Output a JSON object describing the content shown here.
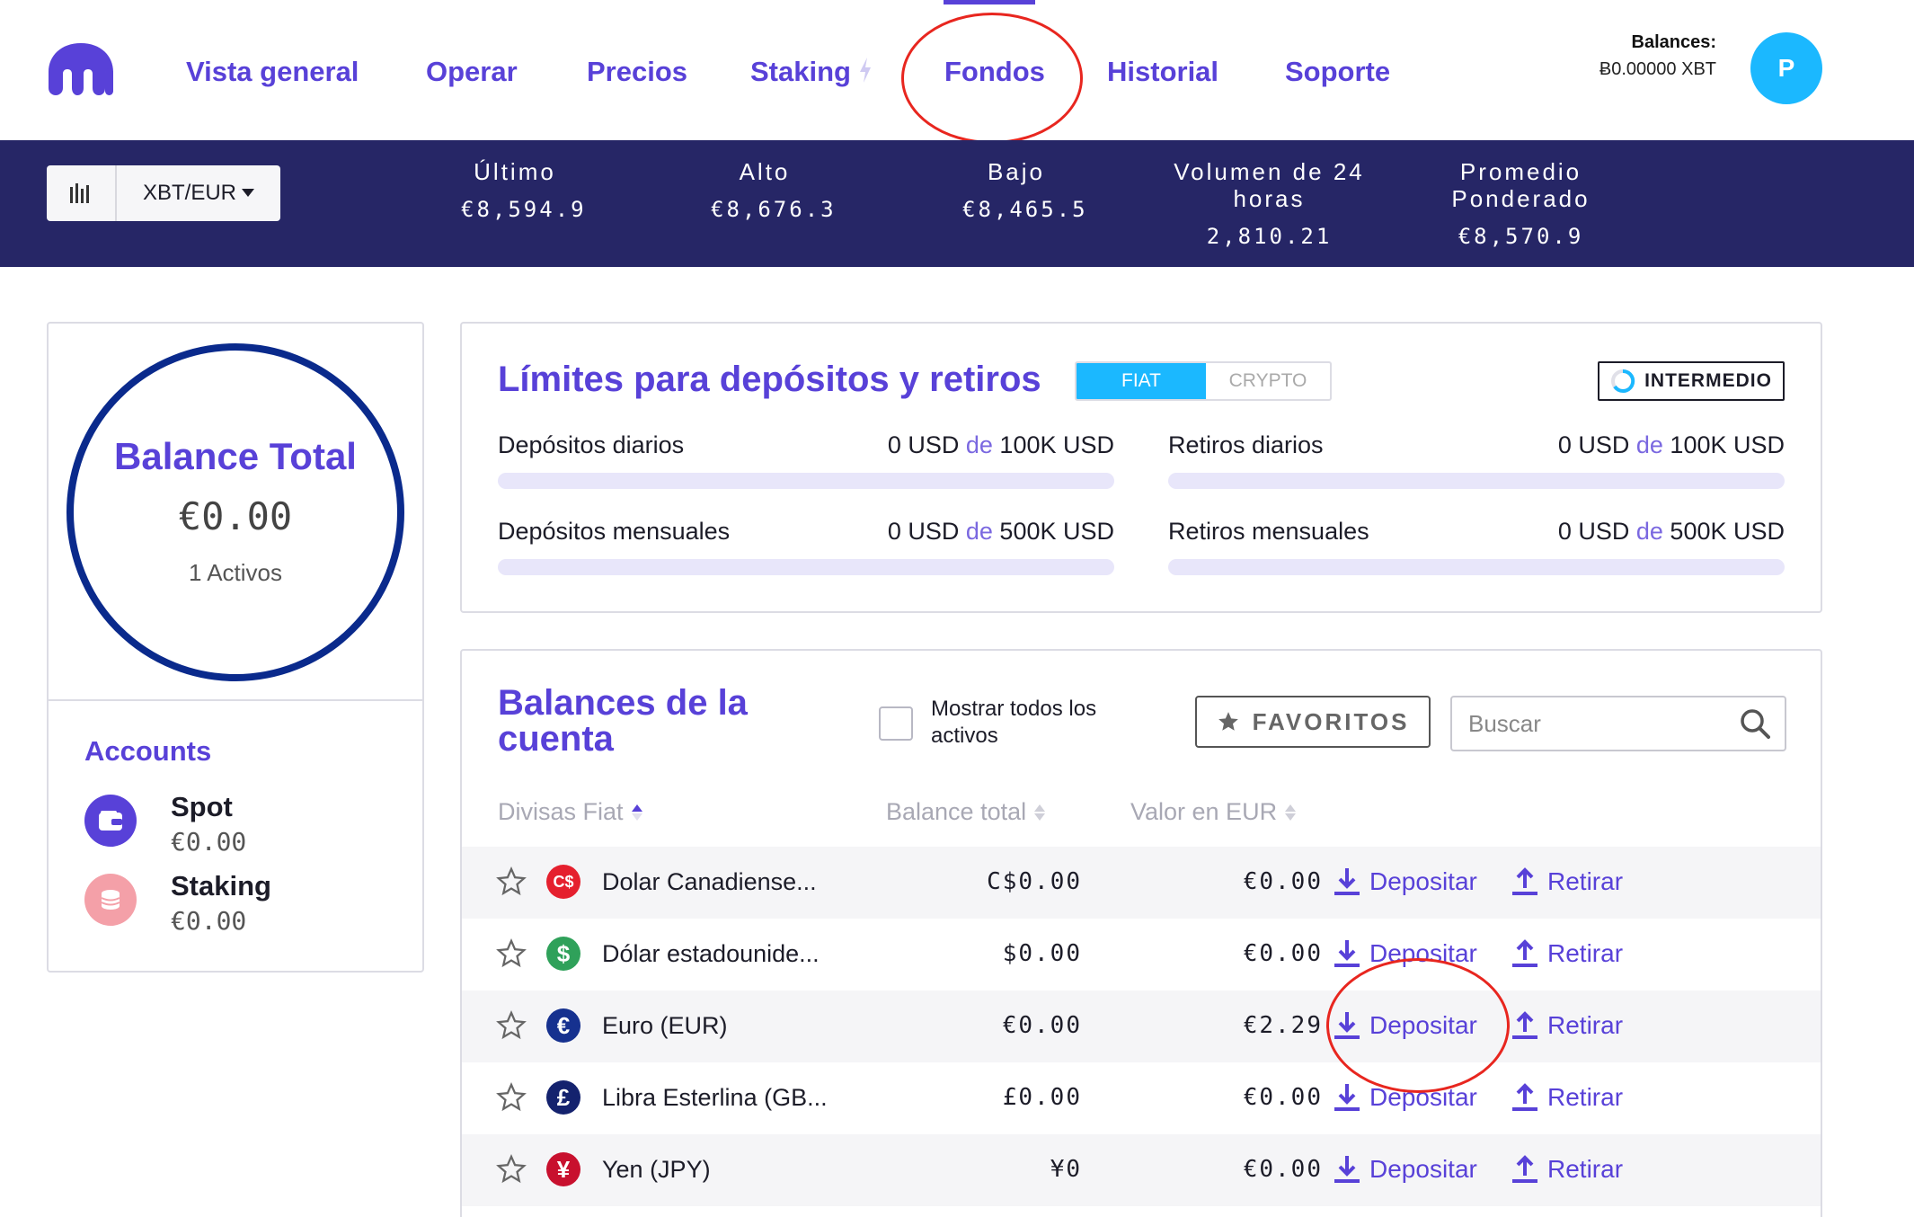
{
  "nav": {
    "items": [
      "Vista general",
      "Operar",
      "Precios",
      "Staking",
      "Fondos",
      "Historial",
      "Soporte"
    ],
    "active": "Fondos",
    "balances_label": "Balances:",
    "balances_value": "Ƀ0.00000 XBT",
    "avatar_initial": "P",
    "accent_color": "#5841d8"
  },
  "ticker": {
    "pair": "XBT/EUR",
    "stats": [
      {
        "label": "Último",
        "value": "€8,594.9"
      },
      {
        "label": "Alto",
        "value": "€8,676.3"
      },
      {
        "label": "Bajo",
        "value": "€8,465.5"
      },
      {
        "label": "Volumen de 24 horas",
        "value": "2,810.21"
      },
      {
        "label": "Promedio Ponderado",
        "value": "€8,570.9"
      }
    ]
  },
  "summary": {
    "title": "Balance Total",
    "value": "€0.00",
    "assets": "1 Activos",
    "accounts_title": "Accounts",
    "accounts": [
      {
        "name": "Spot",
        "value": "€0.00",
        "icon": "wallet-icon",
        "color": "#5841d8"
      },
      {
        "name": "Staking",
        "value": "€0.00",
        "icon": "coins-icon",
        "color": "#f4a0a8"
      }
    ]
  },
  "limits": {
    "title": "Límites para depósitos y retiros",
    "tabs": [
      "FIAT",
      "CRYPTO"
    ],
    "active_tab": "FIAT",
    "tier": "INTERMEDIO",
    "connector": "de",
    "rows": [
      {
        "label": "Depósitos diarios",
        "used": "0 USD",
        "max": "100K USD",
        "progress": 0
      },
      {
        "label": "Retiros diarios",
        "used": "0 USD",
        "max": "100K USD",
        "progress": 0
      },
      {
        "label": "Depósitos mensuales",
        "used": "0 USD",
        "max": "500K USD",
        "progress": 0
      },
      {
        "label": "Retiros mensuales",
        "used": "0 USD",
        "max": "500K USD",
        "progress": 0
      }
    ]
  },
  "balances": {
    "title": "Balances de la cuenta",
    "show_all": "Mostrar todos los activos",
    "favorites": "FAVORITOS",
    "search_placeholder": "Buscar",
    "columns": [
      "Divisas Fiat",
      "Balance total",
      "Valor en EUR"
    ],
    "deposit_label": "Depositar",
    "withdraw_label": "Retirar",
    "rows": [
      {
        "name": "Dolar Canadiense...",
        "symbol": "C$",
        "color": "#e5202e",
        "balance": "C$0.00",
        "eur": "€0.00"
      },
      {
        "name": "Dólar estadounide...",
        "symbol": "$",
        "color": "#2fa15a",
        "balance": "$0.00",
        "eur": "€0.00"
      },
      {
        "name": "Euro (EUR)",
        "symbol": "€",
        "color": "#16318f",
        "balance": "€0.00",
        "eur": "€2.29"
      },
      {
        "name": "Libra Esterlina (GB...",
        "symbol": "£",
        "color": "#14226e",
        "balance": "£0.00",
        "eur": "€0.00"
      },
      {
        "name": "Yen (JPY)",
        "symbol": "¥",
        "color": "#c8102e",
        "balance": "¥0",
        "eur": "€0.00"
      }
    ]
  }
}
